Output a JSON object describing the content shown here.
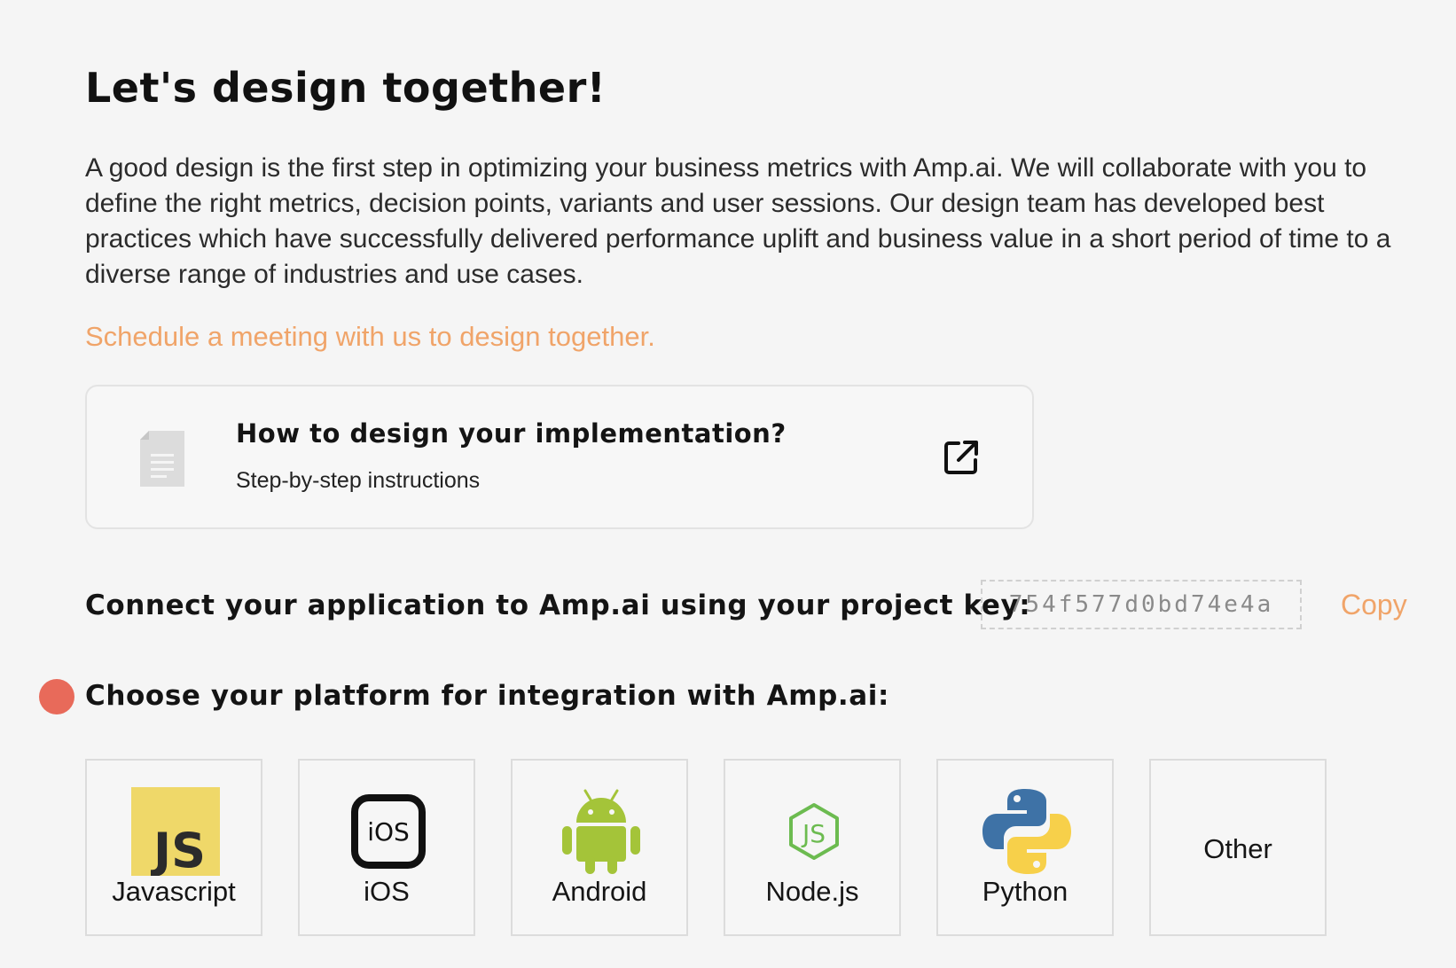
{
  "page": {
    "title": "Let's design together!",
    "intro": "A good design is the first step in optimizing your business metrics with Amp.ai. We will collaborate with you to define the right metrics, decision points, variants and user sessions. Our design team has developed best practices which have successfully delivered performance uplift and business value in a short period of time to a diverse range of industries and use cases.",
    "schedule_link": "Schedule a meeting with us to design together."
  },
  "guide_card": {
    "title": "How to design your implementation?",
    "subtitle": "Step-by-step instructions",
    "icon": "document-icon",
    "action_icon": "external-link-icon"
  },
  "project_key": {
    "label": "Connect your application to Amp.ai using your project key:",
    "value": "754f577d0bd74e4a",
    "copy_label": "Copy"
  },
  "platforms": {
    "label": "Choose your platform for integration with Amp.ai:",
    "status_color": "#e86a5a",
    "items": [
      {
        "label": "Javascript",
        "icon": "javascript-icon",
        "badge": "JS"
      },
      {
        "label": "iOS",
        "icon": "ios-icon",
        "badge": "iOS"
      },
      {
        "label": "Android",
        "icon": "android-icon"
      },
      {
        "label": "Node.js",
        "icon": "nodejs-icon",
        "badge": "JS"
      },
      {
        "label": "Python",
        "icon": "python-icon"
      },
      {
        "label": "Other"
      }
    ]
  },
  "colors": {
    "accent": "#f0a469",
    "background": "#f5f5f5",
    "status_dot": "#e86a5a"
  }
}
